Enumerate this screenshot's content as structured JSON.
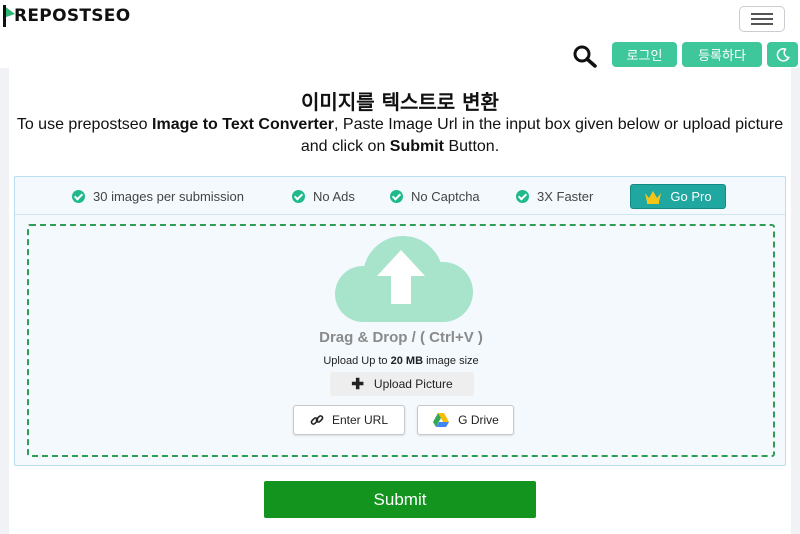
{
  "header": {
    "logo_text": "REPOSTSEO",
    "menu_icon": "hamburger-menu-icon",
    "search_icon": "search-icon",
    "login_label": "로그인",
    "register_label": "등록하다",
    "dark_mode_icon": "moon-icon"
  },
  "main": {
    "title": "이미지를 텍스트로 변환",
    "desc_pre": "To use prepostseo ",
    "desc_bold1": "Image to Text Converter",
    "desc_mid": ", Paste Image Url in the input box given below or upload picture and click on ",
    "desc_bold2": "Submit",
    "desc_post": " Button."
  },
  "features": [
    {
      "label": "30 images per submission"
    },
    {
      "label": "No Ads"
    },
    {
      "label": "No Captcha"
    },
    {
      "label": "3X Faster"
    }
  ],
  "gopro": {
    "label": "Go Pro",
    "icon": "crown-icon"
  },
  "dropzone": {
    "cloud_icon": "cloud-upload-icon",
    "drag_text": "Drag & Drop / ( Ctrl+V )",
    "size_pre": "Upload Up to ",
    "size_bold": "20 MB",
    "size_post": " image size",
    "upload_label": "Upload Picture",
    "url_label": "Enter URL",
    "gdrive_label": "G Drive"
  },
  "submit": {
    "label": "Submit"
  },
  "colors": {
    "accent": "#3fc79c",
    "check": "#1fb98b",
    "submit": "#12941f",
    "gopro": "#1fa7a0",
    "dashed_border": "#2e9e54",
    "cloud": "#a8e3cc"
  }
}
